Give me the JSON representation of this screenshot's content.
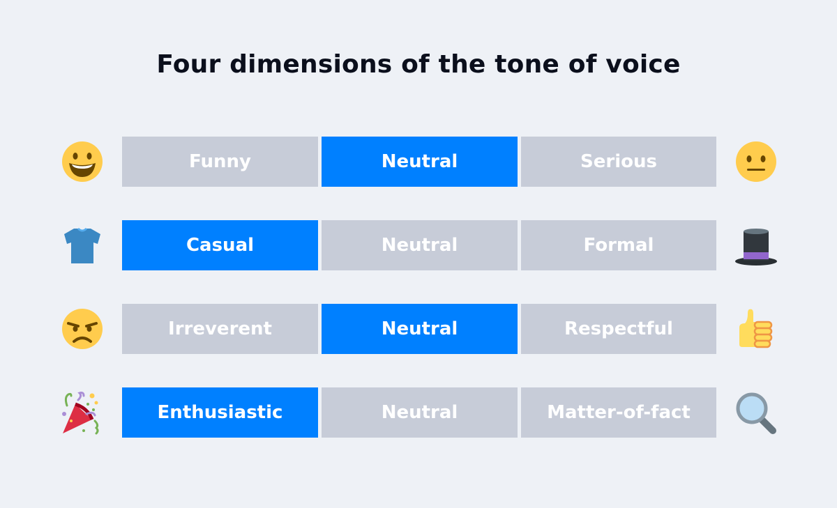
{
  "title": "Four dimensions of the tone of voice",
  "colors": {
    "active": "#0080ff",
    "inactive": "#c7ccd8",
    "background": "#eef1f6",
    "text": "#ffffff",
    "title": "#0b0f1c"
  },
  "rows": [
    {
      "left_icon": "grinning-face-icon",
      "right_icon": "neutral-face-icon",
      "options": [
        "Funny",
        "Neutral",
        "Serious"
      ],
      "selected": 1
    },
    {
      "left_icon": "t-shirt-icon",
      "right_icon": "top-hat-icon",
      "options": [
        "Casual",
        "Neutral",
        "Formal"
      ],
      "selected": 0
    },
    {
      "left_icon": "angry-face-icon",
      "right_icon": "thumbs-up-icon",
      "options": [
        "Irreverent",
        "Neutral",
        "Respectful"
      ],
      "selected": 1
    },
    {
      "left_icon": "party-popper-icon",
      "right_icon": "magnifying-glass-icon",
      "options": [
        "Enthusiastic",
        "Neutral",
        "Matter-of-fact"
      ],
      "selected": 0
    }
  ]
}
